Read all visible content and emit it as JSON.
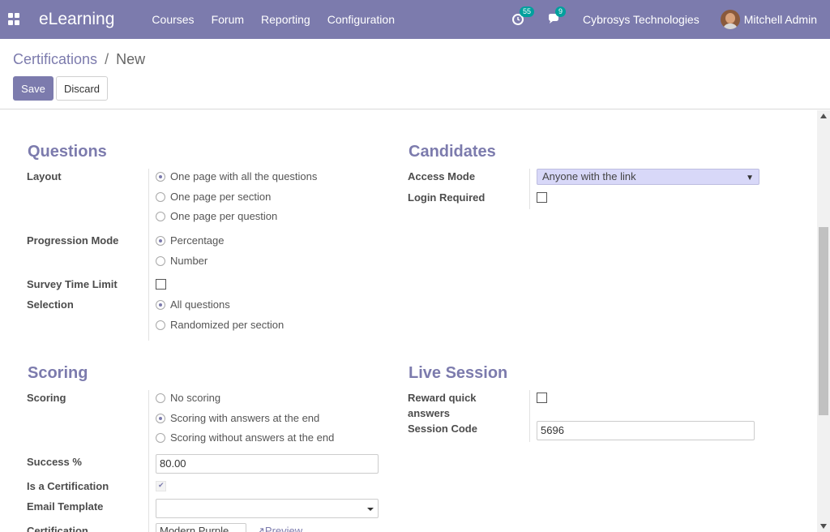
{
  "navbar": {
    "brand": "eLearning",
    "menu": [
      "Courses",
      "Forum",
      "Reporting",
      "Configuration"
    ],
    "activity_count": "55",
    "message_count": "9",
    "company": "Cybrosys Technologies",
    "user": "Mitchell Admin"
  },
  "breadcrumb": {
    "parent": "Certifications",
    "separator": "/",
    "current": "New"
  },
  "buttons": {
    "save": "Save",
    "discard": "Discard"
  },
  "questions": {
    "title": "Questions",
    "layout_label": "Layout",
    "layout_options": [
      "One page with all the questions",
      "One page per section",
      "One page per question"
    ],
    "layout_selected": 0,
    "progression_label": "Progression Mode",
    "progression_options": [
      "Percentage",
      "Number"
    ],
    "progression_selected": 0,
    "time_limit_label": "Survey Time Limit",
    "time_limit_checked": false,
    "selection_label": "Selection",
    "selection_options": [
      "All questions",
      "Randomized per section"
    ],
    "selection_selected": 0
  },
  "candidates": {
    "title": "Candidates",
    "access_label": "Access Mode",
    "access_value": "Anyone with the link",
    "login_label": "Login Required",
    "login_checked": false
  },
  "scoring": {
    "title": "Scoring",
    "scoring_label": "Scoring",
    "scoring_options": [
      "No scoring",
      "Scoring with answers at the end",
      "Scoring without answers at the end"
    ],
    "scoring_selected": 1,
    "success_label": "Success %",
    "success_value": "80.00",
    "certification_label": "Is a Certification",
    "certification_checked": true,
    "email_label": "Email Template",
    "email_value": "",
    "cert_template_label": "Certification",
    "cert_template_value": "Modern Purple",
    "preview_label": "Preview"
  },
  "live_session": {
    "title": "Live Session",
    "reward_label_line1": "Reward quick",
    "reward_label_line2": "answers",
    "reward_checked": false,
    "session_code_label": "Session Code",
    "session_code_value": "5696"
  }
}
